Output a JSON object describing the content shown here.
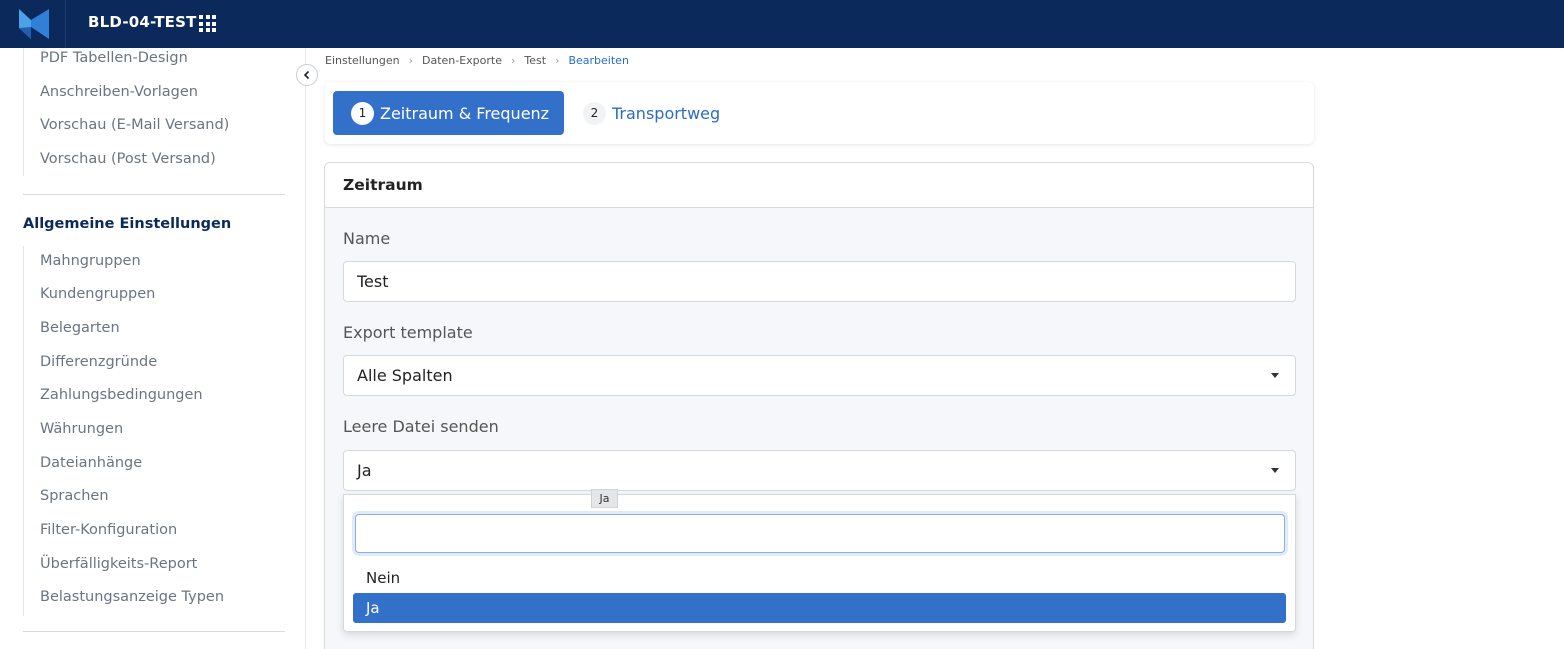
{
  "app": {
    "title": "BLD-04-TEST"
  },
  "sidebar": {
    "top_items": [
      "PDF Tabellen-Design",
      "Anschreiben-Vorlagen",
      "Vorschau (E-Mail Versand)",
      "Vorschau (Post Versand)"
    ],
    "section_heading": "Allgemeine Einstellungen",
    "section_items": [
      "Mahngruppen",
      "Kundengruppen",
      "Belegarten",
      "Differenzgründe",
      "Zahlungsbedingungen",
      "Währungen",
      "Dateianhänge",
      "Sprachen",
      "Filter-Konfiguration",
      "Überfälligkeits-Report",
      "Belastungsanzeige Typen"
    ]
  },
  "breadcrumb": [
    "Einstellungen",
    "Daten-Exporte",
    "Test",
    "Bearbeiten"
  ],
  "steps": [
    {
      "num": "1",
      "label": "Zeitraum & Frequenz",
      "active": true
    },
    {
      "num": "2",
      "label": "Transportweg",
      "active": false
    }
  ],
  "panel": {
    "title": "Zeitraum",
    "name_label": "Name",
    "name_value": "Test",
    "template_label": "Export template",
    "template_value": "Alle Spalten",
    "empty_label": "Leere Datei senden",
    "empty_value": "Ja"
  },
  "dropdown": {
    "search_value": "",
    "options": [
      "Nein",
      "Ja"
    ],
    "selected": "Ja"
  },
  "tooltip": "Ja",
  "colors": {
    "topbar": "#0b2a5b",
    "accent": "#3370c9",
    "link": "#2a6cc4"
  }
}
